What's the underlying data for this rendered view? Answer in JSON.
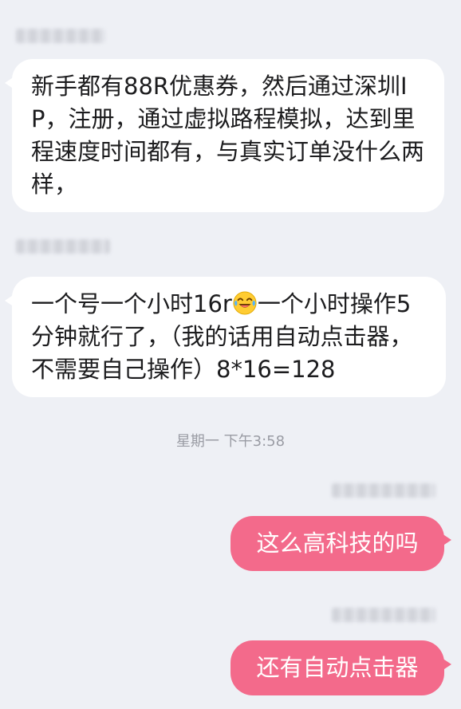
{
  "messages": [
    {
      "direction": "incoming",
      "text": "新手都有88R优惠券，然后通过深圳IP，注册，通过虚拟路程模拟，达到里程速度时间都有，与真实订单没什么两样，"
    },
    {
      "direction": "incoming",
      "text_part1": "一个号一个小时16r",
      "emoji": "tears-of-joy-emoji",
      "text_part2": "一个小时操作5分钟就行了，（我的话用自动点击器，不需要自己操作）8*16=128"
    },
    {
      "direction": "outgoing",
      "text": "这么高科技的吗"
    },
    {
      "direction": "outgoing",
      "text": "还有自动点击器"
    }
  ],
  "timestamp": "星期一 下午3:58",
  "colors": {
    "background": "#eef0f5",
    "incoming_bubble": "#ffffff",
    "outgoing_bubble": "#f36a8b",
    "outgoing_text": "#ffffff",
    "incoming_text": "#1c1c1e",
    "timestamp_text": "#9a9ca4"
  }
}
